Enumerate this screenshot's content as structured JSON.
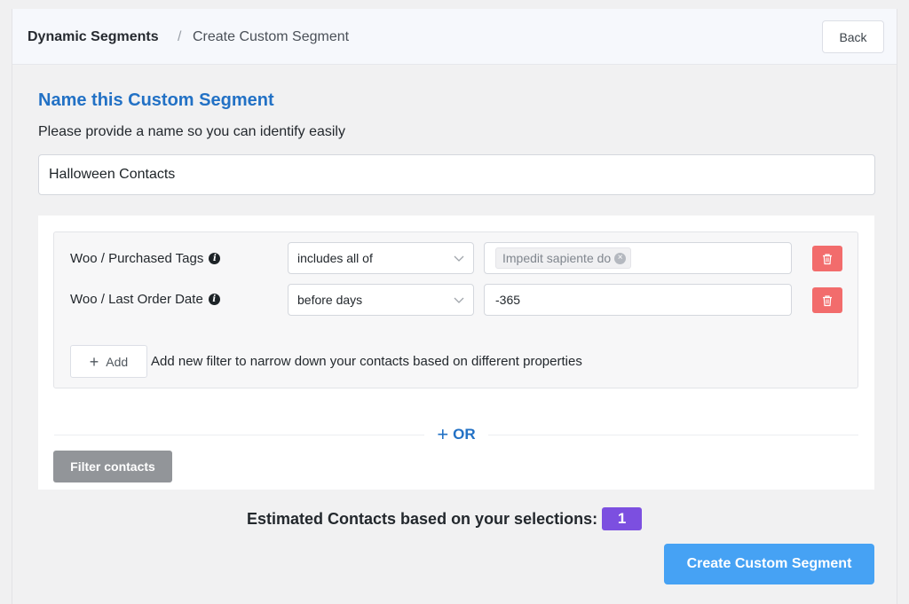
{
  "header": {
    "breadcrumb_root": "Dynamic Segments",
    "breadcrumb_separator": "/",
    "breadcrumb_current": "Create Custom Segment",
    "back_label": "Back"
  },
  "form": {
    "title": "Name this Custom Segment",
    "subtitle": "Please provide a name so you can identify easily",
    "name_value": "Halloween Contacts"
  },
  "filters": {
    "rules": [
      {
        "label": "Woo / Purchased Tags",
        "operator": "includes all of",
        "tags": [
          "Impedit sapiente do"
        ]
      },
      {
        "label": "Woo / Last Order Date",
        "operator": "before days",
        "value": "-365"
      }
    ],
    "add_label": "Add",
    "add_help": "Add new filter to narrow down your contacts based on different properties",
    "or_label": "OR",
    "filter_button": "Filter contacts"
  },
  "estimate": {
    "label": "Estimated Contacts based on your selections:",
    "count": "1"
  },
  "create_button": "Create Custom Segment",
  "colors": {
    "accent": "#2271c5",
    "primary_button": "#46a2f4",
    "delete": "#f26c6c",
    "badge": "#7c4fe0",
    "filter_button": "#929599"
  },
  "icons": {
    "info": "info-icon",
    "chevron": "chevron-down-icon",
    "delete": "trash-icon",
    "add": "plus-icon",
    "chip_close": "close-icon"
  }
}
